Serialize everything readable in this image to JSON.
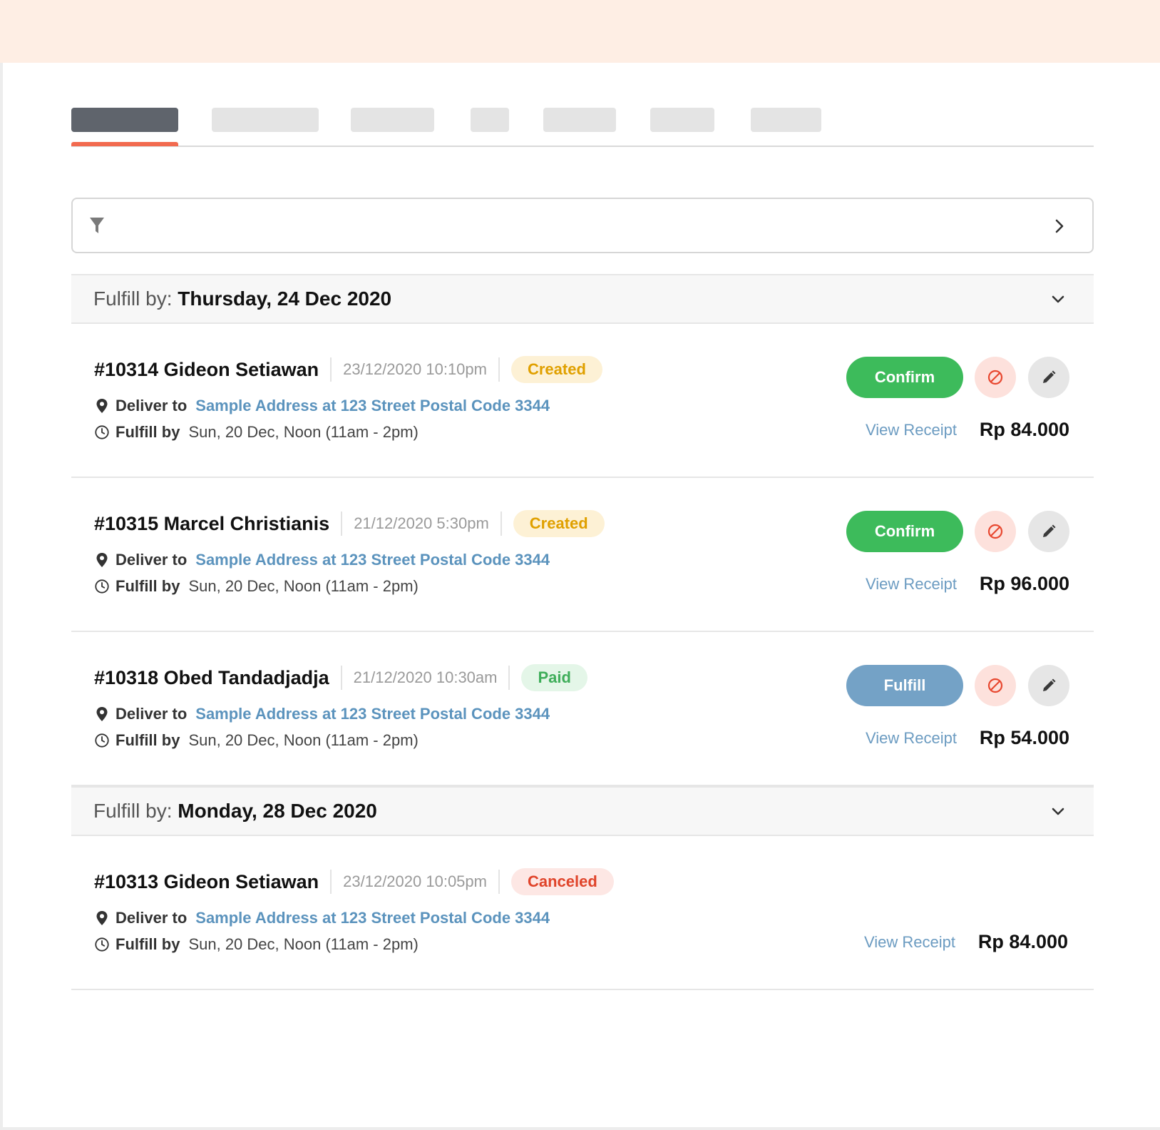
{
  "colors": {
    "top_band": "#feeee4",
    "tab_active": "#5f646c",
    "tab_underline": "#f26a4f",
    "confirm_green": "#3dbb5b",
    "fulfill_blue": "#74a2c6",
    "link_blue": "#5b93bd"
  },
  "filter": {
    "icon": "funnel-icon",
    "chevron": "chevron-right-icon"
  },
  "groups": [
    {
      "label": "Fulfill by:",
      "date": "Thursday, 24 Dec 2020",
      "orders": [
        {
          "title": "#10314 Gideon Setiawan",
          "timestamp": "23/12/2020 10:10pm",
          "status": "Created",
          "deliver_label": "Deliver to",
          "address": "Sample Address at 123 Street Postal Code 3344",
          "fulfill_label": "Fulfill by",
          "fulfill_time": "Sun, 20 Dec, Noon (11am - 2pm)",
          "action": "Confirm",
          "receipt": "View Receipt",
          "price": "Rp 84.000"
        },
        {
          "title": "#10315 Marcel Christianis",
          "timestamp": "21/12/2020 5:30pm",
          "status": "Created",
          "deliver_label": "Deliver to",
          "address": "Sample Address at 123 Street Postal Code 3344",
          "fulfill_label": "Fulfill by",
          "fulfill_time": "Sun, 20 Dec, Noon (11am - 2pm)",
          "action": "Confirm",
          "receipt": "View Receipt",
          "price": "Rp 96.000"
        },
        {
          "title": "#10318 Obed Tandadjadja",
          "timestamp": "21/12/2020 10:30am",
          "status": "Paid",
          "deliver_label": "Deliver to",
          "address": "Sample Address at 123 Street Postal Code 3344",
          "fulfill_label": "Fulfill by",
          "fulfill_time": "Sun, 20 Dec, Noon (11am - 2pm)",
          "action": "Fulfill",
          "receipt": "View Receipt",
          "price": "Rp 54.000"
        }
      ]
    },
    {
      "label": "Fulfill by:",
      "date": "Monday, 28 Dec 2020",
      "orders": [
        {
          "title": "#10313 Gideon Setiawan",
          "timestamp": "23/12/2020 10:05pm",
          "status": "Canceled",
          "deliver_label": "Deliver to",
          "address": "Sample Address at 123 Street Postal Code 3344",
          "fulfill_label": "Fulfill by",
          "fulfill_time": "Sun, 20 Dec, Noon (11am - 2pm)",
          "receipt": "View Receipt",
          "price": "Rp 84.000"
        }
      ]
    }
  ]
}
